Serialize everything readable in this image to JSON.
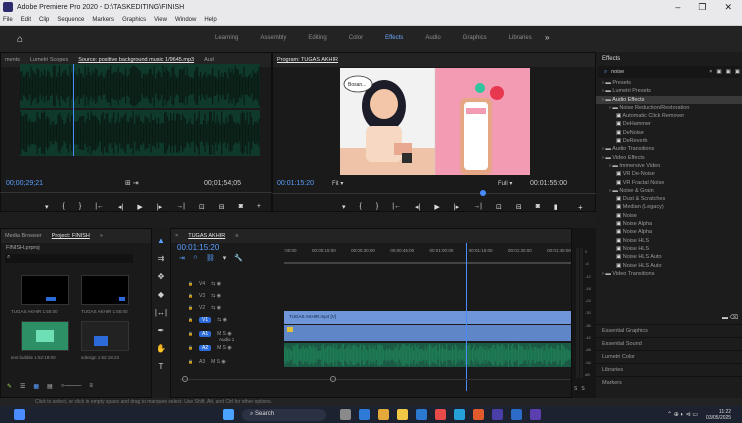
{
  "window": {
    "title": "Adobe Premiere Pro 2020 - D:\\TASKEDITING\\FINISH",
    "controls": [
      "–",
      "❐",
      "✕"
    ]
  },
  "menu": [
    "File",
    "Edit",
    "Clip",
    "Sequence",
    "Markers",
    "Graphics",
    "View",
    "Window",
    "Help"
  ],
  "workspaces": {
    "items": [
      "Learning",
      "Assembly",
      "Editing",
      "Color",
      "Effects",
      "Audio",
      "Graphics",
      "Libraries"
    ],
    "active": "Effects",
    "more": "»"
  },
  "source": {
    "tabs": [
      "ments",
      "Lumetri Scopes",
      "Source: positive background music 1/9645.mp3",
      "Aud"
    ],
    "timecode_left": "00;00;29;21",
    "timecode_right": "00;01;54;05"
  },
  "program": {
    "tab": "Program: TUGAS AKHIR",
    "timecode_left": "00:01:15:20",
    "fit": "Fit",
    "quality": "Full",
    "timecode_right": "00:01:55:00",
    "speech": "Bosan..."
  },
  "effects": {
    "title": "Effects",
    "search_value": "noise",
    "items": [
      {
        "label": "Presets",
        "level": 0,
        "type": "folder"
      },
      {
        "label": "Lumetri Presets",
        "level": 0,
        "type": "folder"
      },
      {
        "label": "Audio Effects",
        "level": 0,
        "type": "folder",
        "selected": true
      },
      {
        "label": "Noise Reduction/Restoration",
        "level": 1,
        "type": "folder"
      },
      {
        "label": "Automatic Click Remover",
        "level": 2,
        "type": "fx"
      },
      {
        "label": "DeHammer",
        "level": 2,
        "type": "fx"
      },
      {
        "label": "DeNoise",
        "level": 2,
        "type": "fx"
      },
      {
        "label": "DeReverb",
        "level": 2,
        "type": "fx"
      },
      {
        "label": "Audio Transitions",
        "level": 0,
        "type": "folder"
      },
      {
        "label": "Video Effects",
        "level": 0,
        "type": "folder"
      },
      {
        "label": "Immersive Video",
        "level": 1,
        "type": "folder"
      },
      {
        "label": "VR De-Noise",
        "level": 2,
        "type": "fx"
      },
      {
        "label": "VR Fractal Noise",
        "level": 2,
        "type": "fx"
      },
      {
        "label": "Noise & Grain",
        "level": 1,
        "type": "folder"
      },
      {
        "label": "Dust & Scratches",
        "level": 2,
        "type": "fx"
      },
      {
        "label": "Median (Legacy)",
        "level": 2,
        "type": "fx"
      },
      {
        "label": "Noise",
        "level": 2,
        "type": "fx"
      },
      {
        "label": "Noise Alpha",
        "level": 2,
        "type": "fx"
      },
      {
        "label": "Noise Alpha",
        "level": 2,
        "type": "fx"
      },
      {
        "label": "Noise HLS",
        "level": 2,
        "type": "fx"
      },
      {
        "label": "Noise HLS",
        "level": 2,
        "type": "fx"
      },
      {
        "label": "Noise HLS Auto",
        "level": 2,
        "type": "fx"
      },
      {
        "label": "Noise HLS Auto",
        "level": 2,
        "type": "fx"
      },
      {
        "label": "Video Transitions",
        "level": 0,
        "type": "folder"
      }
    ],
    "bottom_panels": [
      "Essential Graphics",
      "Essential Sound",
      "Lumetri Color",
      "Libraries",
      "Markers"
    ]
  },
  "project": {
    "tabs": [
      "Media Browser",
      "Project: FINISH",
      "»"
    ],
    "file": "FINISH.prproj",
    "thumbs": [
      {
        "name": "TUGAS AKHIR",
        "duration": "1:55:00"
      },
      {
        "name": "TUGAS AKHIR",
        "duration": "1:55:00"
      },
      {
        "name": "text bubble",
        "duration": "1:52:18:00"
      },
      {
        "name": "sdesign",
        "duration": "1:52:18:23"
      }
    ]
  },
  "timeline": {
    "tab": "TUGAS AKHIR",
    "timecode": "00:01:15:20",
    "ruler": [
      ":00:00",
      "00:00:15:00",
      "00:00:30:00",
      "00:00:45:00",
      "00:01:00:00",
      "00:01:15:00",
      "00:01:30:00",
      "00:01:45:00"
    ],
    "tracks": [
      {
        "name": "V4"
      },
      {
        "name": "V3"
      },
      {
        "name": "V2"
      },
      {
        "name": "V1"
      },
      {
        "name": "A1"
      },
      {
        "name": "A2"
      },
      {
        "name": "A3"
      }
    ],
    "clip_label": "TUGAS AKHIR.mp4 [V]",
    "audio_label": "Audio 1"
  },
  "meter": {
    "ticks": [
      "0",
      "-6",
      "-12",
      "-18",
      "-24",
      "-30",
      "-36",
      "-42",
      "-48",
      "-54",
      "dB"
    ],
    "solo": [
      "S",
      "S"
    ]
  },
  "status": "Click to select, or click in empty space and drag to marquee select. Use Shift, Alt, and Ctrl for other options.",
  "taskbar": {
    "search": "Search",
    "time": "11:22",
    "date": "03/05/2025"
  },
  "colors": {
    "accent": "#2b6ad8",
    "timecode": "#5aa0ff",
    "waveform": "#1f7d55",
    "playhead": "#4a8cff"
  }
}
